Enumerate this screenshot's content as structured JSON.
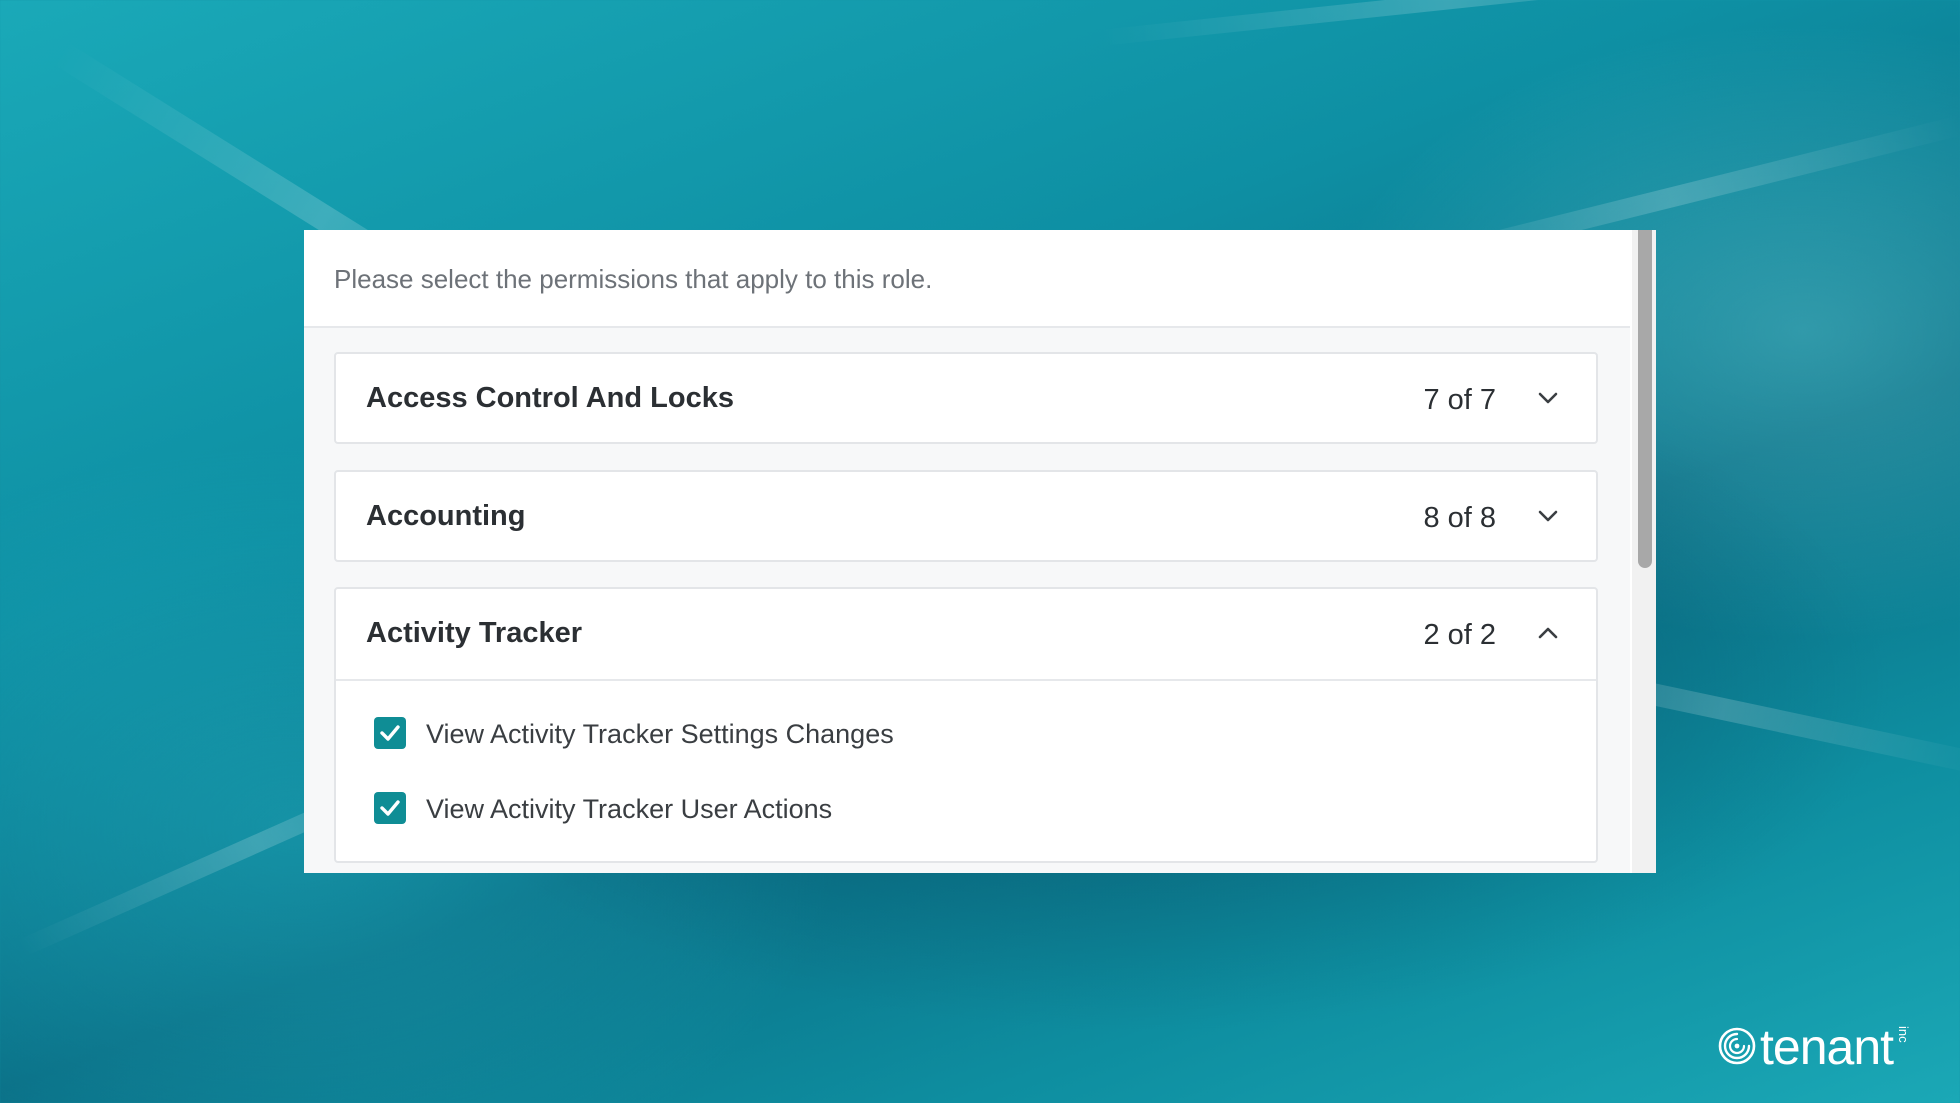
{
  "intro_text": "Please select the permissions that apply to this role.",
  "groups": [
    {
      "title": "Access Control And Locks",
      "count": "7 of 7",
      "expanded": false
    },
    {
      "title": "Accounting",
      "count": "8 of 8",
      "expanded": false
    },
    {
      "title": "Activity Tracker",
      "count": "2 of 2",
      "expanded": true,
      "permissions": [
        {
          "label": "View Activity Tracker Settings Changes",
          "checked": true
        },
        {
          "label": "View Activity Tracker User Actions",
          "checked": true
        }
      ]
    }
  ],
  "logo": {
    "text": "tenant",
    "suffix": "inc"
  },
  "colors": {
    "accent": "#0f8d95",
    "background": "#0e8fa3"
  },
  "icons": {
    "collapsed": "chevron-down-icon",
    "expanded": "chevron-up-icon",
    "checked": "checkmark-icon",
    "logo": "tenant-swirl-icon"
  }
}
